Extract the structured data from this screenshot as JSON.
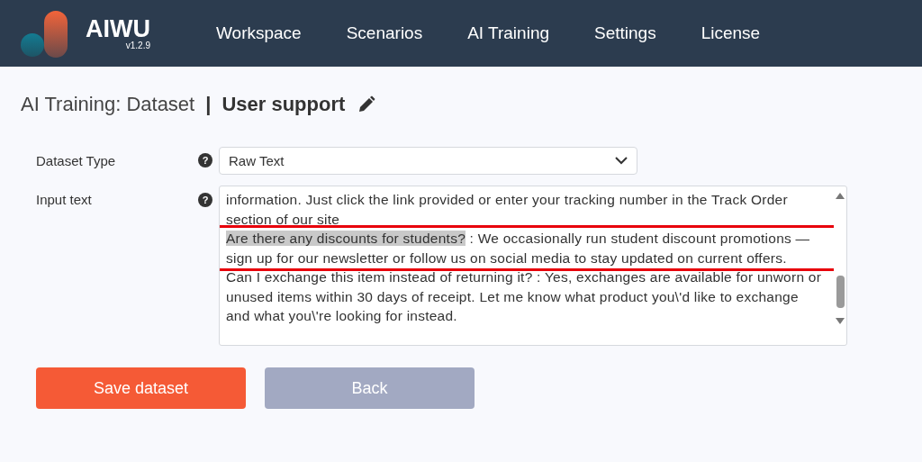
{
  "app": {
    "name": "AIWU",
    "version": "v1.2.9"
  },
  "nav": [
    {
      "label": "Workspace"
    },
    {
      "label": "Scenarios"
    },
    {
      "label": "AI Training"
    },
    {
      "label": "Settings"
    },
    {
      "label": "License"
    }
  ],
  "header": {
    "section": "AI Training: Dataset",
    "separator": "|",
    "dataset_name": "User support"
  },
  "form": {
    "fields": [
      {
        "kind": "select",
        "label": "Dataset Type",
        "help": "?",
        "value": "Raw Text"
      },
      {
        "kind": "textarea",
        "label": "Input text",
        "help": "?",
        "entries": [
          {
            "text": "information. Just click the link provided or enter your tracking number in the Track Order section of our site",
            "annotated": false
          },
          {
            "selection": "Are there any discounts for students?",
            "text": " : We occasionally run student discount promotions — sign up for our newsletter or follow us on social media to stay updated on current offers.",
            "annotated": true
          },
          {
            "text": "Can I exchange this item instead of returning it? : Yes, exchanges are available for unworn or unused items within 30 days of receipt. Let me know what product you\\'d like to exchange and what you\\'re looking for instead.",
            "annotated": false
          }
        ]
      }
    ]
  },
  "buttons": [
    {
      "kind": "primary",
      "label": "Save dataset"
    },
    {
      "kind": "secondary",
      "label": "Back"
    }
  ]
}
